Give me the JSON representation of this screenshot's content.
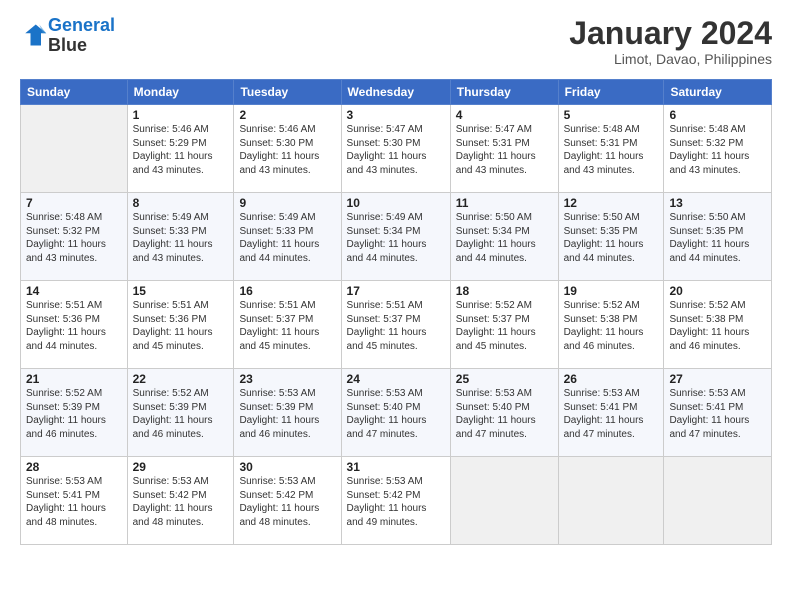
{
  "header": {
    "logo_line1": "General",
    "logo_line2": "Blue",
    "month": "January 2024",
    "location": "Limot, Davao, Philippines"
  },
  "days_of_week": [
    "Sunday",
    "Monday",
    "Tuesday",
    "Wednesday",
    "Thursday",
    "Friday",
    "Saturday"
  ],
  "weeks": [
    [
      {
        "day": "",
        "info": ""
      },
      {
        "day": "1",
        "info": "Sunrise: 5:46 AM\nSunset: 5:29 PM\nDaylight: 11 hours\nand 43 minutes."
      },
      {
        "day": "2",
        "info": "Sunrise: 5:46 AM\nSunset: 5:30 PM\nDaylight: 11 hours\nand 43 minutes."
      },
      {
        "day": "3",
        "info": "Sunrise: 5:47 AM\nSunset: 5:30 PM\nDaylight: 11 hours\nand 43 minutes."
      },
      {
        "day": "4",
        "info": "Sunrise: 5:47 AM\nSunset: 5:31 PM\nDaylight: 11 hours\nand 43 minutes."
      },
      {
        "day": "5",
        "info": "Sunrise: 5:48 AM\nSunset: 5:31 PM\nDaylight: 11 hours\nand 43 minutes."
      },
      {
        "day": "6",
        "info": "Sunrise: 5:48 AM\nSunset: 5:32 PM\nDaylight: 11 hours\nand 43 minutes."
      }
    ],
    [
      {
        "day": "7",
        "info": "Sunrise: 5:48 AM\nSunset: 5:32 PM\nDaylight: 11 hours\nand 43 minutes."
      },
      {
        "day": "8",
        "info": "Sunrise: 5:49 AM\nSunset: 5:33 PM\nDaylight: 11 hours\nand 43 minutes."
      },
      {
        "day": "9",
        "info": "Sunrise: 5:49 AM\nSunset: 5:33 PM\nDaylight: 11 hours\nand 44 minutes."
      },
      {
        "day": "10",
        "info": "Sunrise: 5:49 AM\nSunset: 5:34 PM\nDaylight: 11 hours\nand 44 minutes."
      },
      {
        "day": "11",
        "info": "Sunrise: 5:50 AM\nSunset: 5:34 PM\nDaylight: 11 hours\nand 44 minutes."
      },
      {
        "day": "12",
        "info": "Sunrise: 5:50 AM\nSunset: 5:35 PM\nDaylight: 11 hours\nand 44 minutes."
      },
      {
        "day": "13",
        "info": "Sunrise: 5:50 AM\nSunset: 5:35 PM\nDaylight: 11 hours\nand 44 minutes."
      }
    ],
    [
      {
        "day": "14",
        "info": "Sunrise: 5:51 AM\nSunset: 5:36 PM\nDaylight: 11 hours\nand 44 minutes."
      },
      {
        "day": "15",
        "info": "Sunrise: 5:51 AM\nSunset: 5:36 PM\nDaylight: 11 hours\nand 45 minutes."
      },
      {
        "day": "16",
        "info": "Sunrise: 5:51 AM\nSunset: 5:37 PM\nDaylight: 11 hours\nand 45 minutes."
      },
      {
        "day": "17",
        "info": "Sunrise: 5:51 AM\nSunset: 5:37 PM\nDaylight: 11 hours\nand 45 minutes."
      },
      {
        "day": "18",
        "info": "Sunrise: 5:52 AM\nSunset: 5:37 PM\nDaylight: 11 hours\nand 45 minutes."
      },
      {
        "day": "19",
        "info": "Sunrise: 5:52 AM\nSunset: 5:38 PM\nDaylight: 11 hours\nand 46 minutes."
      },
      {
        "day": "20",
        "info": "Sunrise: 5:52 AM\nSunset: 5:38 PM\nDaylight: 11 hours\nand 46 minutes."
      }
    ],
    [
      {
        "day": "21",
        "info": "Sunrise: 5:52 AM\nSunset: 5:39 PM\nDaylight: 11 hours\nand 46 minutes."
      },
      {
        "day": "22",
        "info": "Sunrise: 5:52 AM\nSunset: 5:39 PM\nDaylight: 11 hours\nand 46 minutes."
      },
      {
        "day": "23",
        "info": "Sunrise: 5:53 AM\nSunset: 5:39 PM\nDaylight: 11 hours\nand 46 minutes."
      },
      {
        "day": "24",
        "info": "Sunrise: 5:53 AM\nSunset: 5:40 PM\nDaylight: 11 hours\nand 47 minutes."
      },
      {
        "day": "25",
        "info": "Sunrise: 5:53 AM\nSunset: 5:40 PM\nDaylight: 11 hours\nand 47 minutes."
      },
      {
        "day": "26",
        "info": "Sunrise: 5:53 AM\nSunset: 5:41 PM\nDaylight: 11 hours\nand 47 minutes."
      },
      {
        "day": "27",
        "info": "Sunrise: 5:53 AM\nSunset: 5:41 PM\nDaylight: 11 hours\nand 47 minutes."
      }
    ],
    [
      {
        "day": "28",
        "info": "Sunrise: 5:53 AM\nSunset: 5:41 PM\nDaylight: 11 hours\nand 48 minutes."
      },
      {
        "day": "29",
        "info": "Sunrise: 5:53 AM\nSunset: 5:42 PM\nDaylight: 11 hours\nand 48 minutes."
      },
      {
        "day": "30",
        "info": "Sunrise: 5:53 AM\nSunset: 5:42 PM\nDaylight: 11 hours\nand 48 minutes."
      },
      {
        "day": "31",
        "info": "Sunrise: 5:53 AM\nSunset: 5:42 PM\nDaylight: 11 hours\nand 49 minutes."
      },
      {
        "day": "",
        "info": ""
      },
      {
        "day": "",
        "info": ""
      },
      {
        "day": "",
        "info": ""
      }
    ]
  ]
}
